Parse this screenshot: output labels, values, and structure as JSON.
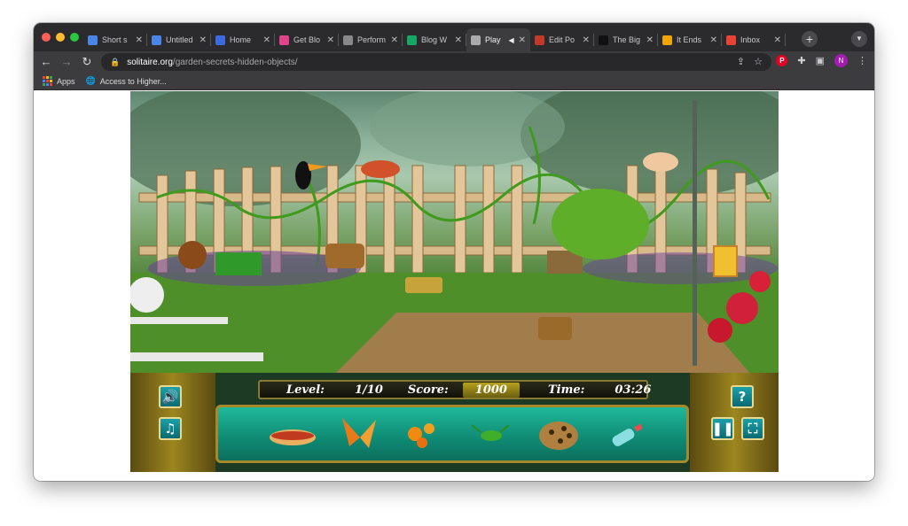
{
  "browser": {
    "tabs": [
      {
        "title": "Short s",
        "favicon_color": "#4a86e8",
        "favicon": "docs-icon"
      },
      {
        "title": "Untitled",
        "favicon_color": "#4a86e8",
        "favicon": "docs-icon"
      },
      {
        "title": "Home",
        "favicon_color": "#3b6be0",
        "favicon": "home-icon"
      },
      {
        "title": "Get Blo",
        "favicon_color": "#e0438a",
        "favicon": "blog-icon"
      },
      {
        "title": "Perform",
        "favicon_color": "#888888",
        "favicon": "chart-icon"
      },
      {
        "title": "Blog W",
        "favicon_color": "#16a765",
        "favicon": "sheets-icon"
      },
      {
        "title": "Play",
        "favicon_color": "#aaaaaa",
        "favicon": "globe-icon",
        "active": true
      },
      {
        "title": "Edit Po",
        "favicon_color": "#c0392b",
        "favicon": "edit-icon"
      },
      {
        "title": "The Big",
        "favicon_color": "#111111",
        "favicon": "n-icon"
      },
      {
        "title": "It Ends",
        "favicon_color": "#f0a500",
        "favicon": "amazon-icon"
      },
      {
        "title": "Inbox",
        "favicon_color": "#ea4335",
        "favicon": "gmail-icon"
      }
    ],
    "url_domain": "solitaire.org",
    "url_path": "/garden-secrets-hidden-objects/",
    "bookmarks": [
      {
        "label": "Apps"
      },
      {
        "label": "Access to Higher..."
      }
    ],
    "profile_initial": "N"
  },
  "game": {
    "level_label": "Level:",
    "level_value": "1/10",
    "score_label": "Score:",
    "score_value": "1000",
    "time_label": "Time:",
    "time_value": "03:26",
    "items_to_find": [
      "hotdog",
      "butterfly",
      "orange-flowers",
      "grasshopper",
      "leopard-hat",
      "bottle"
    ],
    "help_label": "?"
  }
}
